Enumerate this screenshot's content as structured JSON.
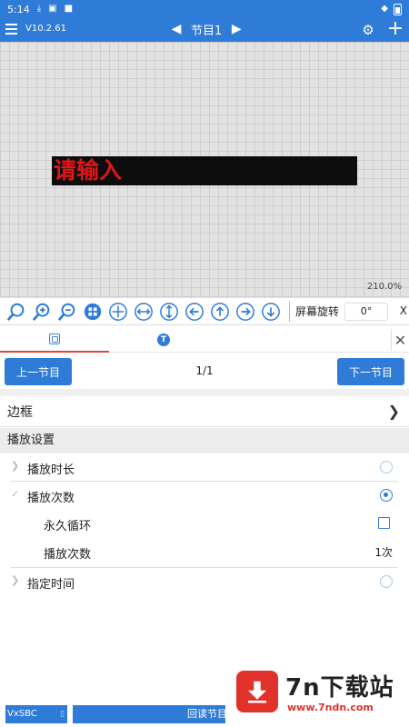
{
  "status_bar": {
    "time": "5:14"
  },
  "app_bar": {
    "version": "V10.2.61",
    "program_title": "节目1"
  },
  "canvas": {
    "led_text": "请输入",
    "led_text_color": "#e01515",
    "zoom": "210.0%"
  },
  "toolbar": {
    "rotate_label": "屏幕旋转",
    "rotate_value": "0°",
    "extra_label": "X"
  },
  "tabs": [
    {
      "icon": "image-frame-icon"
    },
    {
      "icon": "text-t-icon"
    }
  ],
  "navigation": {
    "prev_label": "上一节目",
    "page_indicator": "1/1",
    "next_label": "下一节目"
  },
  "border_row": {
    "label": "边框"
  },
  "play_settings": {
    "header": "播放设置",
    "play_duration": "播放时长",
    "play_count_title": "播放次数",
    "loop_forever": "永久循环",
    "play_count_label": "播放次数",
    "play_count_value": "1次",
    "specified_time": "指定时间"
  },
  "bottom_bar": {
    "wx_label": "VxSBC",
    "read_label": "回读节目"
  },
  "watermark": {
    "title": "7n下载站",
    "url": "www.7ndn.com"
  },
  "colors": {
    "primary": "#2f7bd8",
    "accent_red": "#e0453a"
  }
}
